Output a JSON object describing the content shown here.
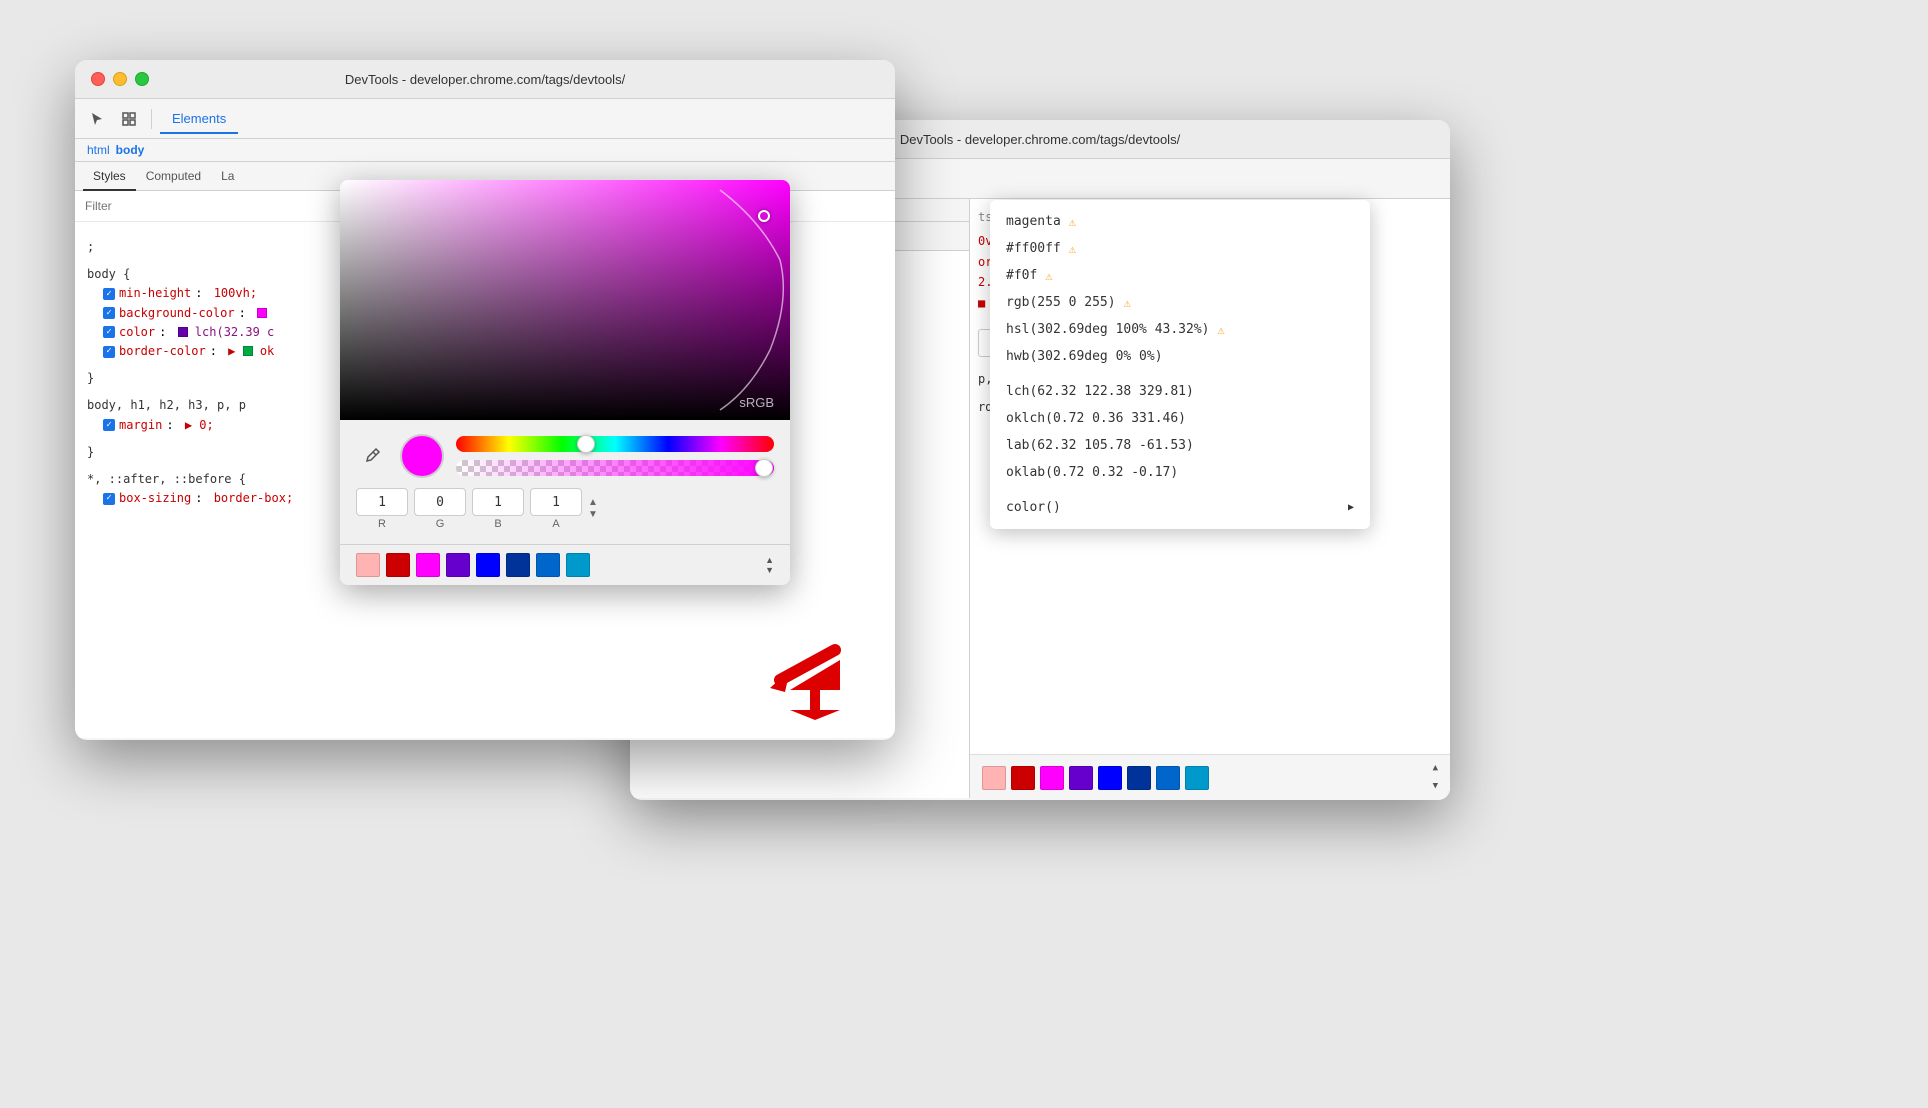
{
  "back_window": {
    "title": "DevTools - developer.chrome.com/tags/devtools/",
    "tabs": [
      "Elements"
    ],
    "panel_tabs": [
      "Styles",
      "Computed",
      "La"
    ],
    "breadcrumbs": [
      "html",
      "body"
    ],
    "css_rules": [
      {
        "selector": "body {",
        "properties": [
          {
            "enabled": true,
            "name": "min-height",
            "value": "100vh;"
          },
          {
            "enabled": true,
            "name": "background-color",
            "value": "■"
          },
          {
            "enabled": true,
            "name": "color",
            "value": "■ lch(32.39 c..."
          },
          {
            "enabled": true,
            "name": "border-color",
            "value": "▶ ■ ok..."
          }
        ],
        "close": "}"
      },
      {
        "selector": "body, h1, h2, h3, p, p",
        "properties": [
          {
            "enabled": true,
            "name": "margin",
            "value": "▶ 0;"
          }
        ],
        "close": "}"
      },
      {
        "selector": "*, ::after, ::before {",
        "properties": [
          {
            "enabled": true,
            "name": "box-sizing",
            "value": "border-box;"
          }
        ]
      }
    ],
    "right_panel": {
      "tabs_visible": [
        "ts",
        "La"
      ],
      "code_lines": [
        "0vh;",
        "or:",
        "2.39 c",
        "ok"
      ],
      "input_value": "1",
      "input_label": "R",
      "code_after": "p, p",
      "border_box_line": "rder-box;"
    },
    "swatches": [
      "#ffb3b3",
      "#cc0000",
      "#ff00ff",
      "#6600cc",
      "#0000ff",
      "#003399",
      "#0066cc",
      "#0099cc"
    ]
  },
  "front_window": {
    "title": "DevTools - developer.chrome.com/tags/devtools/",
    "tabs": [
      "Elements"
    ],
    "panel_tabs": [
      "Styles",
      "Computed",
      "La"
    ],
    "breadcrumbs": [
      "html",
      "body"
    ],
    "filter_placeholder": "Filter"
  },
  "color_picker": {
    "canvas_label": "sRGB",
    "hue_slider_position": "38%",
    "alpha_slider_position": "97%",
    "preview_color": "#ff00ff",
    "inputs": [
      {
        "label": "R",
        "value": "1"
      },
      {
        "label": "G",
        "value": "0"
      },
      {
        "label": "B",
        "value": "1"
      },
      {
        "label": "A",
        "value": "1"
      }
    ],
    "swatches": [
      "#ffb3b3",
      "#cc0000",
      "#ff00ff",
      "#6600cc",
      "#0000ff",
      "#003399",
      "#0066cc",
      "#0099cc"
    ]
  },
  "color_dropdown": {
    "items": [
      {
        "text": "magenta",
        "warning": true,
        "arrow": false
      },
      {
        "text": "#ff00ff",
        "warning": true,
        "arrow": false
      },
      {
        "text": "#f0f",
        "warning": true,
        "arrow": false
      },
      {
        "text": "rgb(255 0 255)",
        "warning": true,
        "arrow": false
      },
      {
        "text": "hsl(302.69deg 100% 43.32%)",
        "warning": true,
        "arrow": false
      },
      {
        "text": "hwb(302.69deg 0% 0%)",
        "warning": false,
        "arrow": false
      },
      {
        "divider": true
      },
      {
        "text": "lch(62.32 122.38 329.81)",
        "warning": false,
        "arrow": false
      },
      {
        "text": "oklch(0.72 0.36 331.46)",
        "warning": false,
        "arrow": false
      },
      {
        "text": "lab(62.32 105.78 -61.53)",
        "warning": false,
        "arrow": false
      },
      {
        "text": "oklab(0.72 0.32 -0.17)",
        "warning": false,
        "arrow": false
      },
      {
        "divider": true
      },
      {
        "text": "color()",
        "warning": false,
        "arrow": true
      }
    ]
  },
  "icons": {
    "cursor": "⬕",
    "inspect": "⊡",
    "close": "✕",
    "eyedropper": "🔬",
    "chevron_up": "▲",
    "chevron_down": "▼",
    "warning": "⚠"
  }
}
